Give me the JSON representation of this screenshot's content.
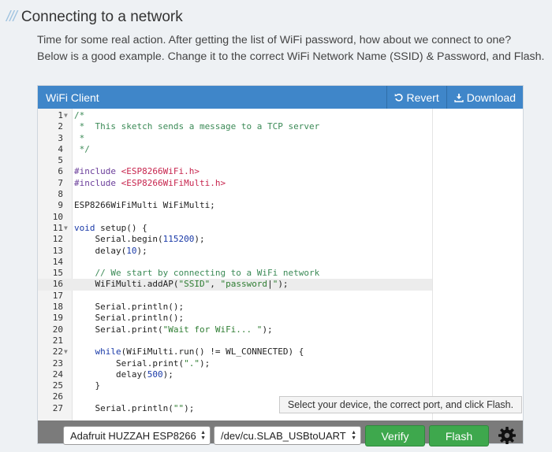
{
  "section": {
    "slashes": "///",
    "title": "Connecting to a network"
  },
  "intro": {
    "line1": "Time for some real action. After getting the list of WiFi password, how about we connect to one?",
    "line2": "Below is a good example. Change it to the correct WiFi Network Name (SSID) & Password, and Flash."
  },
  "panel": {
    "title": "WiFi Client",
    "revert_label": "Revert",
    "download_label": "Download",
    "accent_color": "#3f86c9"
  },
  "code_lines": [
    {
      "n": "1",
      "fold": true,
      "html": "<span style='color:#3b8a56'>/*</span>"
    },
    {
      "n": "2",
      "html": "<span style='color:#3b8a56'> *  This sketch sends a message to a TCP server</span>"
    },
    {
      "n": "3",
      "html": "<span style='color:#3b8a56'> *</span>"
    },
    {
      "n": "4",
      "html": "<span style='color:#3b8a56'> */</span>"
    },
    {
      "n": "5",
      "html": ""
    },
    {
      "n": "6",
      "html": "<span style='color:#6a3d9a'>#include</span> <span style='color:#c7254e'>&lt;ESP8266WiFi.h&gt;</span>"
    },
    {
      "n": "7",
      "html": "<span style='color:#6a3d9a'>#include</span> <span style='color:#c7254e'>&lt;ESP8266WiFiMulti.h&gt;</span>"
    },
    {
      "n": "8",
      "html": ""
    },
    {
      "n": "9",
      "html": "ESP8266WiFiMulti WiFiMulti;"
    },
    {
      "n": "10",
      "html": ""
    },
    {
      "n": "11",
      "fold": true,
      "html": "<span style='color:#1a3aa8'>void</span> setup() {"
    },
    {
      "n": "12",
      "html": "    Serial.begin(<span style='color:#1a3aa8'>115200</span>);"
    },
    {
      "n": "13",
      "html": "    delay(<span style='color:#1a3aa8'>10</span>);"
    },
    {
      "n": "14",
      "html": ""
    },
    {
      "n": "15",
      "html": "    <span style='color:#3b8a56'>// We start by connecting to a WiFi network</span>"
    },
    {
      "n": "16",
      "active": true,
      "html": "    WiFiMulti.addAP(<span style='color:#2e7d32'>\"SSID\"</span>, <span style='color:#2e7d32'>\"password</span>|<span style='color:#2e7d32'>\"</span>);"
    },
    {
      "n": "17",
      "html": ""
    },
    {
      "n": "18",
      "html": "    Serial.println();"
    },
    {
      "n": "19",
      "html": "    Serial.println();"
    },
    {
      "n": "20",
      "html": "    Serial.print(<span style='color:#2e7d32'>\"Wait for WiFi... \"</span>);"
    },
    {
      "n": "21",
      "html": ""
    },
    {
      "n": "22",
      "fold": true,
      "html": "    <span style='color:#1a3aa8'>while</span>(WiFiMulti.run() != WL_CONNECTED) {"
    },
    {
      "n": "23",
      "html": "        Serial.print(<span style='color:#2e7d32'>\".\"</span>);"
    },
    {
      "n": "24",
      "html": "        delay(<span style='color:#1a3aa8'>500</span>);"
    },
    {
      "n": "25",
      "html": "    }"
    },
    {
      "n": "26",
      "html": ""
    },
    {
      "n": "27",
      "html": "    Serial.println(<span style='color:#2e7d32'>\"\"</span>);"
    }
  ],
  "tooltip": "Select your device, the correct port, and click Flash.",
  "toolbar": {
    "device_selected": "Adafruit HUZZAH ESP8266",
    "port_selected": "/dev/cu.SLAB_USBtoUART",
    "verify_label": "Verify",
    "flash_label": "Flash",
    "button_color": "#3ea84d",
    "settings_icon": "gear-icon"
  }
}
